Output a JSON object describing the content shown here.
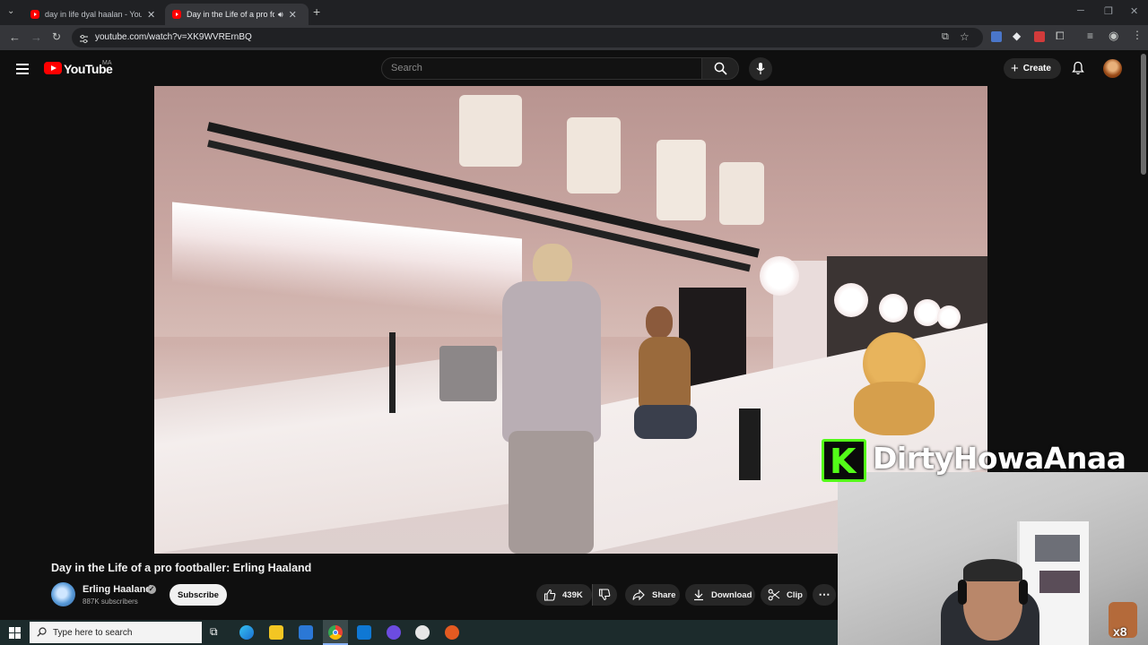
{
  "browser": {
    "tabs": [
      {
        "title": "day in life dyal haalan - YouTube"
      },
      {
        "title": "Day in the Life of a pro footballer: Erling Haaland - YouTube"
      }
    ],
    "new_tab": "+",
    "url": "youtube.com/watch?v=XK9WVRErnBQ",
    "window_controls": {
      "minimize": "─",
      "maximize": "❐",
      "close": "✕"
    }
  },
  "masthead": {
    "logo": "YouTube",
    "country_code": "MA",
    "search_placeholder": "Search",
    "create_label": "Create"
  },
  "video": {
    "title": "Day in the Life of a pro footballer: Erling Haaland",
    "channel_name": "Erling Haaland",
    "subscribers": "887K subscribers",
    "subscribe_label": "Subscribe",
    "like_count": "439K",
    "share_label": "Share",
    "download_label": "Download",
    "clip_label": "Clip"
  },
  "overlay": {
    "kick_letter": "K",
    "streamer_name": "DirtyHowaAnaa",
    "badge": "x8"
  },
  "taskbar": {
    "search_placeholder": "Type here to search"
  },
  "colors": {
    "yt_red": "#ff0000",
    "kick_green": "#53fc18",
    "page_bg": "#0f0f0f"
  }
}
